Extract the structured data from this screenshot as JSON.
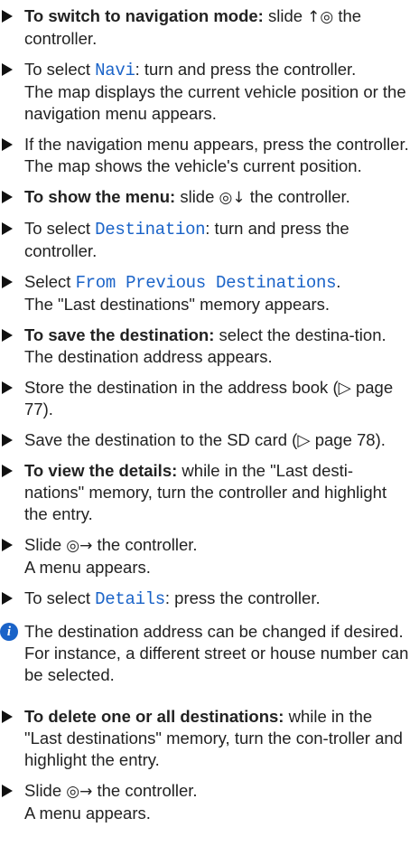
{
  "steps": [
    {
      "bold": "To switch to navigation mode:",
      "pre": " slide ",
      "sym": "↑◎",
      "post": " the controller."
    },
    {
      "pre": "To select ",
      "hl": "Navi",
      "post": ": turn and press the controller.",
      "result": "The map displays the current vehicle position or the navigation menu appears."
    },
    {
      "pre": "If the navigation menu appears, press the controller.",
      "result": "The map shows the vehicle's current position."
    },
    {
      "bold": "To show the menu:",
      "pre": " slide ",
      "sym": "◎↓",
      "post": " the controller."
    },
    {
      "pre": "To select ",
      "hl": "Destination",
      "post": ": turn and press the controller."
    },
    {
      "pre": "Select ",
      "hl": "From Previous Destinations",
      "post": ".",
      "result": "The \"Last destinations\" memory appears."
    },
    {
      "bold": "To save the destination:",
      "pre": " select the destina-tion.",
      "result": "The destination address appears."
    },
    {
      "pre": "Store the destination in the address book (▷ page 77)."
    },
    {
      "pre": "Save the destination to the SD card (▷ page 78)."
    },
    {
      "bold": "To view the details:",
      "pre": " while in the \"Last desti-nations\" memory, turn the controller and highlight the entry."
    },
    {
      "pre": "Slide ",
      "sym": "◎→",
      "post": " the controller.",
      "result": "A menu appears."
    },
    {
      "pre": "To select ",
      "hl": "Details",
      "post": ": press the controller."
    }
  ],
  "note": "The destination address can be changed if desired. For instance, a different street or house number can be selected.",
  "steps2": [
    {
      "bold": "To delete one or all destinations:",
      "pre": " while in the \"Last destinations\" memory, turn the con-troller and highlight the entry."
    },
    {
      "pre": "Slide ",
      "sym": "◎→",
      "post": " the controller.",
      "result": "A menu appears."
    }
  ],
  "colors": {
    "highlight": "#1a63c8",
    "text": "#222222"
  }
}
